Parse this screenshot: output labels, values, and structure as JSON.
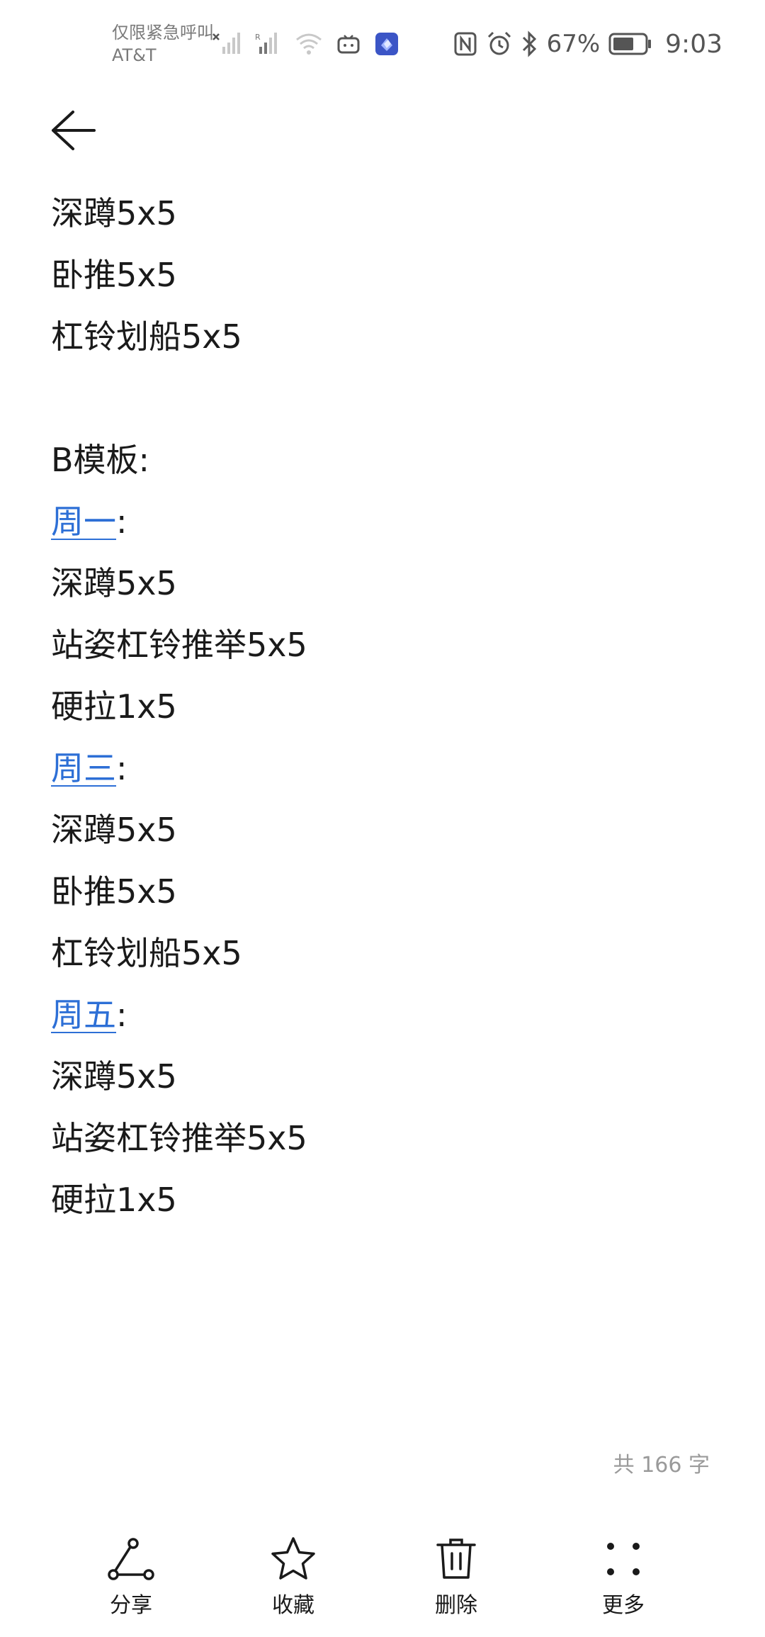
{
  "status_bar": {
    "carrier_line1": "仅限紧急呼叫",
    "carrier_line2": "AT&T",
    "battery_percent": "67%",
    "battery_level": 0.67,
    "time": "9:03",
    "icons": [
      "no-sim-signal-icon",
      "signal-icon",
      "wifi-icon",
      "tv-app-icon",
      "app-icon",
      "nfc-icon",
      "alarm-icon",
      "bluetooth-icon",
      "battery-icon"
    ]
  },
  "header": {
    "back_icon": "arrow-left-icon"
  },
  "note": {
    "lines": [
      {
        "text": "深蹲5x5"
      },
      {
        "text": "卧推5x5"
      },
      {
        "text": "杠铃划船5x5"
      },
      {
        "text": ""
      },
      {
        "text": "B模板:"
      },
      {
        "link": "周一",
        "suffix": ":"
      },
      {
        "text": "深蹲5x5"
      },
      {
        "text": "站姿杠铃推举5x5"
      },
      {
        "text": "硬拉1x5"
      },
      {
        "link": "周三",
        "suffix": ":"
      },
      {
        "text": "深蹲5x5"
      },
      {
        "text": "卧推5x5"
      },
      {
        "text": "杠铃划船5x5"
      },
      {
        "link": "周五",
        "suffix": ":"
      },
      {
        "text": "深蹲5x5"
      },
      {
        "text": "站姿杠铃推举5x5"
      },
      {
        "text": "硬拉1x5"
      }
    ],
    "link_color": "#2d6fd6"
  },
  "footer": {
    "word_count": "共 166 字"
  },
  "toolbar": {
    "share_label": "分享",
    "favorite_label": "收藏",
    "delete_label": "删除",
    "more_label": "更多"
  }
}
